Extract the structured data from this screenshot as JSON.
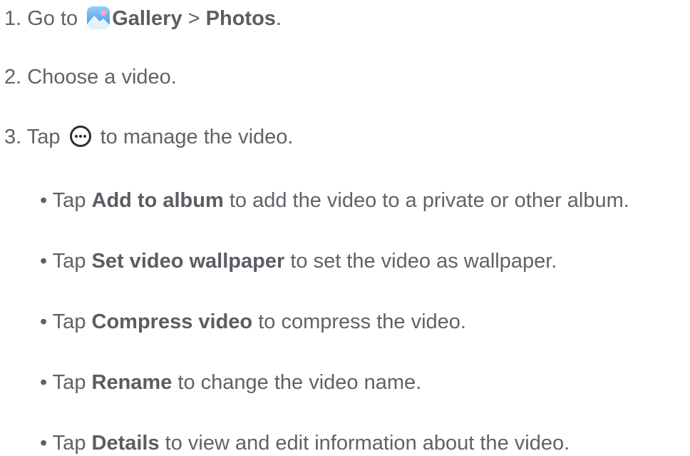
{
  "step1": {
    "prefix": "1. Go to ",
    "app": "Gallery",
    "sep": " > ",
    "section": "Photos",
    "end": "."
  },
  "step2": {
    "text": "2. Choose a video."
  },
  "step3": {
    "prefix": "3. Tap ",
    "icon": "more-options-icon",
    "suffix": " to manage the video."
  },
  "bullets": [
    {
      "pre": "• Tap ",
      "bold": "Add to album",
      "post": " to add the video to a private or other album."
    },
    {
      "pre": "• Tap ",
      "bold": "Set video wallpaper",
      "post": " to set the video as wallpaper."
    },
    {
      "pre": "• Tap ",
      "bold": "Compress video",
      "post": " to compress the video."
    },
    {
      "pre": "• Tap ",
      "bold": "Rename",
      "post": " to change the video name."
    },
    {
      "pre": "• Tap ",
      "bold": "Details",
      "post": " to view and edit information about the video."
    }
  ],
  "colors": {
    "text": "#5f6368",
    "gallery_icon_top": "#7ec3f5",
    "gallery_icon_bottom": "#4a90e2",
    "gallery_icon_accent": "#f6a6c8"
  }
}
